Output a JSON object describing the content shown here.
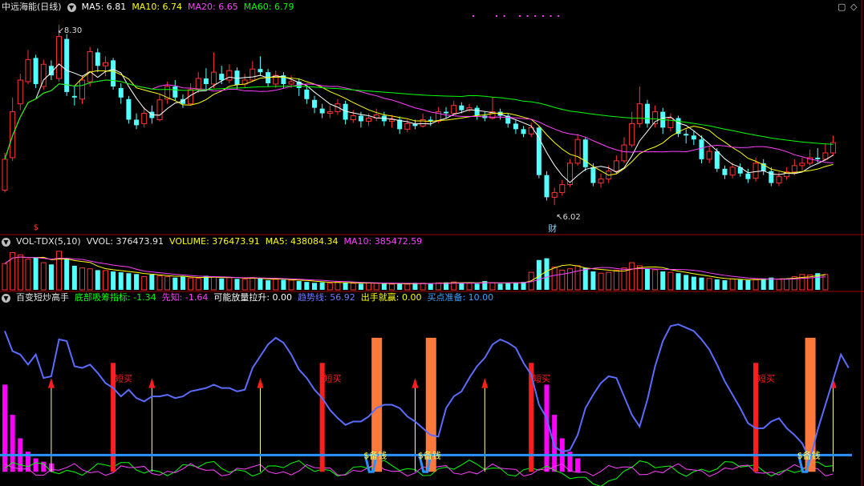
{
  "colors": {
    "up": "#ff3232",
    "down": "#54ffff",
    "ma5": "#ffffff",
    "ma10": "#ffff00",
    "ma20": "#ff40ff",
    "ma60": "#00ff00",
    "trend": "#5a6cff",
    "bottom": "#00ff00",
    "xianzhi": "#ff40ff",
    "line": "#2b93ff",
    "short": "#ff1e1e",
    "money": "#ff7a3a",
    "arrow": "#ffff66"
  },
  "price_panel": {
    "title": "中远海能(日线)",
    "ma5": "MA5: 6.81",
    "ma10": "MA10: 6.74",
    "ma20": "MA20: 6.65",
    "ma60": "MA60: 6.79",
    "high_label": "8.30",
    "low_label": "6.02",
    "cai_label": "财",
    "dollar_label": "$",
    "window_icons": [
      "▢",
      "◇"
    ]
  },
  "volume_panel": {
    "name": "VOL-TDX(5,10)",
    "vvol": "VVOL: 376473.91",
    "volume": "VOLUME: 376473.91",
    "ma5": "MA5: 438084.34",
    "ma10": "MA10: 385472.59"
  },
  "indicator_panel": {
    "name": "百变短炒高手",
    "bottom": "底部吸筹指标: -1.34",
    "xianzhi": "先知: -1.64",
    "fangliang": "可能放量拉升: 0.00",
    "trend": "趋势线: 56.92",
    "chushou": "出手就赢: 0.00",
    "maidian": "买点准备: 10.00",
    "short_buy_label": "短买",
    "money_label": "$备钱"
  },
  "chart_data": {
    "type": "candlestick",
    "price_axis": [
      5.8,
      8.45
    ],
    "candles": [
      [
        6.21,
        6.6,
        6.68,
        6.18
      ],
      [
        6.62,
        7.2,
        7.38,
        6.58
      ],
      [
        7.3,
        7.6,
        7.68,
        7.22
      ],
      [
        7.58,
        7.86,
        7.98,
        7.55
      ],
      [
        7.88,
        7.55,
        7.92,
        7.5
      ],
      [
        7.52,
        7.8,
        7.86,
        7.48
      ],
      [
        7.78,
        7.66,
        7.85,
        7.6
      ],
      [
        7.62,
        8.15,
        8.3,
        7.58
      ],
      [
        8.12,
        7.45,
        8.18,
        7.4
      ],
      [
        7.4,
        7.38,
        7.52,
        7.28
      ],
      [
        7.36,
        7.6,
        7.66,
        7.3
      ],
      [
        7.58,
        7.96,
        8.02,
        7.52
      ],
      [
        7.95,
        7.78,
        8.0,
        7.7
      ],
      [
        7.78,
        7.82,
        7.9,
        7.65
      ],
      [
        7.85,
        7.52,
        7.88,
        7.48
      ],
      [
        7.5,
        7.38,
        7.56,
        7.3
      ],
      [
        7.36,
        7.1,
        7.4,
        7.05
      ],
      [
        7.1,
        7.03,
        7.18,
        6.98
      ],
      [
        7.05,
        7.18,
        7.26,
        7.0
      ],
      [
        7.2,
        7.12,
        7.28,
        7.05
      ],
      [
        7.1,
        7.35,
        7.42,
        7.08
      ],
      [
        7.36,
        7.52,
        7.58,
        7.3
      ],
      [
        7.52,
        7.38,
        7.6,
        7.34
      ],
      [
        7.36,
        7.3,
        7.42,
        7.25
      ],
      [
        7.3,
        7.48,
        7.56,
        7.28
      ],
      [
        7.48,
        7.62,
        7.7,
        7.44
      ],
      [
        7.62,
        7.55,
        7.75,
        7.48
      ],
      [
        7.55,
        7.7,
        7.95,
        7.5
      ],
      [
        7.68,
        7.6,
        7.78,
        7.55
      ],
      [
        7.6,
        7.72,
        7.8,
        7.56
      ],
      [
        7.72,
        7.54,
        7.76,
        7.48
      ],
      [
        7.55,
        7.6,
        7.68,
        7.5
      ],
      [
        7.6,
        7.74,
        7.84,
        7.58
      ],
      [
        7.74,
        7.7,
        7.9,
        7.66
      ],
      [
        7.7,
        7.56,
        7.74,
        7.52
      ],
      [
        7.55,
        7.66,
        7.72,
        7.5
      ],
      [
        7.66,
        7.55,
        7.7,
        7.5
      ],
      [
        7.55,
        7.58,
        7.66,
        7.5
      ],
      [
        7.58,
        7.5,
        7.62,
        7.4
      ],
      [
        7.48,
        7.36,
        7.52,
        7.3
      ],
      [
        7.35,
        7.25,
        7.4,
        7.18
      ],
      [
        7.24,
        7.18,
        7.3,
        7.12
      ],
      [
        7.18,
        7.2,
        7.28,
        7.12
      ],
      [
        7.2,
        7.3,
        7.36,
        7.16
      ],
      [
        7.3,
        7.1,
        7.34,
        7.04
      ],
      [
        7.1,
        7.15,
        7.22,
        7.06
      ],
      [
        7.15,
        7.08,
        7.2,
        7.0
      ],
      [
        7.08,
        7.12,
        7.18,
        7.02
      ],
      [
        7.12,
        7.16,
        7.24,
        7.08
      ],
      [
        7.15,
        7.08,
        7.2,
        7.02
      ],
      [
        7.08,
        7.1,
        7.16,
        7.0
      ],
      [
        7.1,
        6.98,
        7.14,
        6.92
      ],
      [
        6.98,
        7.05,
        7.1,
        6.94
      ],
      [
        7.05,
        7.02,
        7.1,
        6.98
      ],
      [
        7.02,
        7.1,
        7.18,
        7.0
      ],
      [
        7.1,
        7.08,
        7.14,
        7.02
      ],
      [
        7.08,
        7.2,
        7.26,
        7.06
      ],
      [
        7.2,
        7.18,
        7.26,
        7.12
      ],
      [
        7.18,
        7.28,
        7.34,
        7.16
      ],
      [
        7.28,
        7.22,
        7.32,
        7.18
      ],
      [
        7.22,
        7.25,
        7.3,
        7.2
      ],
      [
        7.25,
        7.15,
        7.28,
        7.1
      ],
      [
        7.15,
        7.12,
        7.2,
        7.08
      ],
      [
        7.12,
        7.2,
        7.38,
        7.1
      ],
      [
        7.2,
        7.15,
        7.24,
        7.1
      ],
      [
        7.15,
        7.05,
        7.18,
        7.0
      ],
      [
        7.05,
        6.98,
        7.1,
        6.92
      ],
      [
        6.98,
        6.92,
        7.02,
        6.88
      ],
      [
        6.92,
        7.0,
        7.06,
        6.88
      ],
      [
        7.0,
        6.4,
        7.02,
        6.36
      ],
      [
        6.4,
        6.12,
        6.45,
        6.08
      ],
      [
        6.12,
        6.18,
        6.24,
        6.02
      ],
      [
        6.18,
        6.28,
        6.34,
        6.14
      ],
      [
        6.28,
        6.55,
        6.6,
        6.25
      ],
      [
        6.55,
        6.85,
        6.92,
        6.52
      ],
      [
        6.85,
        6.5,
        6.88,
        6.45
      ],
      [
        6.5,
        6.3,
        6.55,
        6.26
      ],
      [
        6.3,
        6.35,
        6.42,
        6.24
      ],
      [
        6.35,
        6.45,
        6.52,
        6.3
      ],
      [
        6.45,
        6.58,
        6.65,
        6.42
      ],
      [
        6.58,
        6.78,
        6.88,
        6.55
      ],
      [
        6.78,
        7.05,
        7.2,
        6.75
      ],
      [
        7.05,
        7.3,
        7.52,
        7.0
      ],
      [
        7.3,
        7.05,
        7.35,
        7.0
      ],
      [
        7.05,
        7.2,
        7.28,
        7.0
      ],
      [
        7.2,
        7.0,
        7.25,
        6.92
      ],
      [
        7.0,
        7.12,
        7.18,
        6.95
      ],
      [
        7.12,
        6.92,
        7.15,
        6.88
      ],
      [
        6.92,
        6.9,
        6.98,
        6.8
      ],
      [
        6.9,
        6.85,
        6.96,
        6.78
      ],
      [
        6.85,
        6.6,
        6.9,
        6.55
      ],
      [
        6.6,
        6.7,
        6.76,
        6.55
      ],
      [
        6.7,
        6.48,
        6.74,
        6.44
      ],
      [
        6.48,
        6.4,
        6.52,
        6.35
      ],
      [
        6.4,
        6.5,
        6.56,
        6.36
      ],
      [
        6.5,
        6.42,
        6.55,
        6.38
      ],
      [
        6.42,
        6.35,
        6.48,
        6.3
      ],
      [
        6.36,
        6.55,
        6.62,
        6.32
      ],
      [
        6.55,
        6.45,
        6.6,
        6.4
      ],
      [
        6.45,
        6.3,
        6.5,
        6.26
      ],
      [
        6.3,
        6.38,
        6.44,
        6.26
      ],
      [
        6.38,
        6.44,
        6.5,
        6.34
      ],
      [
        6.44,
        6.52,
        6.6,
        6.4
      ],
      [
        6.52,
        6.55,
        6.62,
        6.46
      ],
      [
        6.55,
        6.62,
        6.72,
        6.52
      ],
      [
        6.62,
        6.6,
        6.74,
        6.56
      ],
      [
        6.6,
        6.68,
        6.8,
        6.58
      ],
      [
        6.68,
        6.81,
        6.9,
        6.64
      ]
    ],
    "volume": [
      60,
      85,
      80,
      70,
      74,
      62,
      58,
      88,
      72,
      55,
      50,
      48,
      45,
      44,
      42,
      40,
      38,
      36,
      30,
      35,
      32,
      30,
      28,
      30,
      27,
      26,
      32,
      30,
      26,
      28,
      25,
      24,
      28,
      26,
      22,
      24,
      23,
      22,
      20,
      18,
      16,
      17,
      15,
      18,
      16,
      15,
      14,
      16,
      15,
      14,
      13,
      14,
      13,
      16,
      15,
      14,
      16,
      17,
      18,
      16,
      15,
      14,
      20,
      16,
      14,
      15,
      16,
      18,
      40,
      68,
      72,
      52,
      45,
      48,
      55,
      50,
      42,
      38,
      40,
      45,
      50,
      62,
      55,
      48,
      46,
      42,
      40,
      38,
      34,
      30,
      28,
      26,
      24,
      22,
      25,
      23,
      22,
      24,
      26,
      28,
      24,
      25,
      30,
      35,
      34,
      38,
      35
    ],
    "vol_axis": [
      0,
      95
    ],
    "trend_line": [
      84,
      72,
      70,
      64,
      70,
      56,
      57,
      79,
      78,
      63,
      62,
      64,
      59,
      53,
      50,
      45,
      49,
      44,
      42,
      45,
      45,
      46,
      44,
      45,
      48,
      49,
      50,
      52,
      50,
      50,
      48,
      49,
      62,
      69,
      76,
      80,
      77,
      70,
      61,
      56,
      49,
      44,
      37,
      32,
      28,
      30,
      30,
      33,
      38,
      40,
      40,
      38,
      33,
      30,
      26,
      22,
      21,
      38,
      45,
      48,
      56,
      63,
      68,
      76,
      79,
      77,
      74,
      65,
      58,
      40,
      32,
      15,
      12,
      13,
      22,
      38,
      46,
      53,
      57,
      56,
      45,
      34,
      27,
      43,
      63,
      78,
      87,
      88,
      86,
      84,
      79,
      73,
      64,
      54,
      46,
      38,
      29,
      26,
      26,
      30,
      32,
      26,
      22,
      17,
      7,
      25,
      40,
      55,
      70,
      62
    ],
    "trend_axis": [
      -8,
      100
    ],
    "blue_line_level": 10.0,
    "short_buy_idx": [
      14,
      41,
      68,
      97
    ],
    "money_idx": [
      48,
      55,
      104
    ],
    "arrow_idx": [
      6,
      19,
      33,
      53,
      62,
      107
    ],
    "magenta_bars_ranges": [
      [
        0,
        6
      ],
      [
        70,
        74
      ]
    ],
    "dollar_idx": 4,
    "cai_idx": 71
  }
}
